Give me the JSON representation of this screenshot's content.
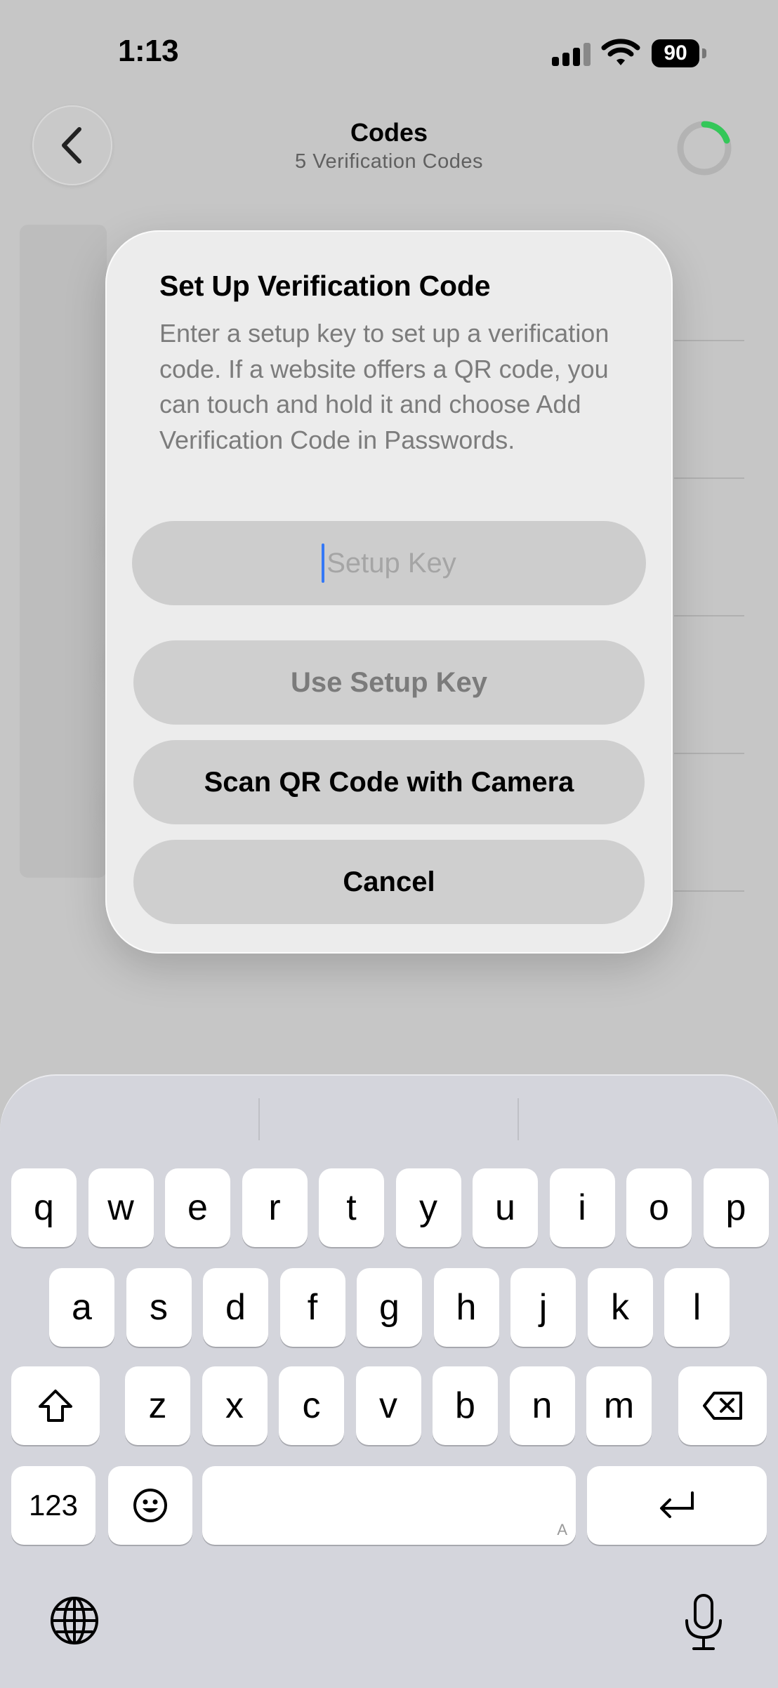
{
  "status": {
    "time": "1:13",
    "battery": "90"
  },
  "nav": {
    "title": "Codes",
    "subtitle": "5 Verification Codes"
  },
  "dialog": {
    "title": "Set Up Verification Code",
    "message": "Enter a setup key to set up a verification code. If a website offers a QR code, you can touch and hold it and choose Add Verification Code in Passwords.",
    "input_placeholder": "Setup Key",
    "use_key_label": "Use Setup Key",
    "scan_label": "Scan QR Code with Camera",
    "cancel_label": "Cancel"
  },
  "keyboard": {
    "row1": [
      "q",
      "w",
      "e",
      "r",
      "t",
      "y",
      "u",
      "i",
      "o",
      "p"
    ],
    "row2": [
      "a",
      "s",
      "d",
      "f",
      "g",
      "h",
      "j",
      "k",
      "l"
    ],
    "row3": [
      "z",
      "x",
      "c",
      "v",
      "b",
      "n",
      "m"
    ],
    "numbers_label": "123",
    "space_hint": "A"
  },
  "colors": {
    "caret": "#3478f6",
    "timer_progress": "#34c759"
  }
}
